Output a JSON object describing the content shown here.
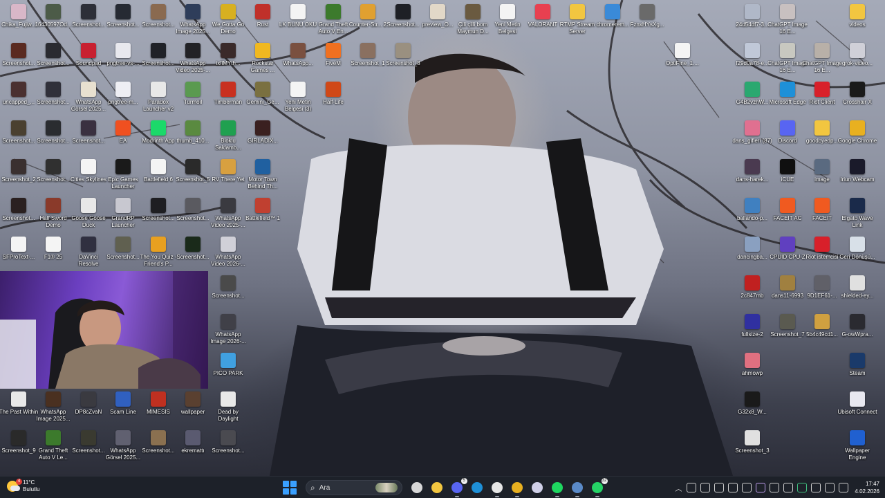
{
  "colors": {
    "taskbar": "#1d2129",
    "accent": "#3aa0ff",
    "label_text": "#ffffff"
  },
  "desktop": {
    "icons": [
      {
        "label": "Chika_Fujiw...",
        "icon": "photo-icon",
        "color": "#d9b7c8"
      },
      {
        "label": "16430597Od...",
        "icon": "photo-icon",
        "color": "#4c5b48"
      },
      {
        "label": "Screenshot...",
        "icon": "screenshot-icon",
        "color": "#2d2f38"
      },
      {
        "label": "Screenshot...",
        "icon": "screenshot-icon",
        "color": "#262a33"
      },
      {
        "label": "Screenshot...",
        "icon": "screenshot-icon",
        "color": "#8a6a50"
      },
      {
        "label": "WhatsApp Image 2025...",
        "icon": "photo-icon",
        "color": "#2e3d5a"
      },
      {
        "label": "We Gotta Go Demo",
        "icon": "game-icon",
        "color": "#d8b020"
      },
      {
        "label": "Rust",
        "icon": "rust-icon",
        "color": "#c0302a"
      },
      {
        "label": "LK BUNU OKU",
        "icon": "text-file-icon",
        "color": "#f4f4f4"
      },
      {
        "label": "Grand Theft Auto V En...",
        "icon": "gta-icon",
        "color": "#3c7a2c"
      },
      {
        "label": "Counter-Str... 2",
        "icon": "cs2-icon",
        "color": "#e0a030"
      },
      {
        "label": "Screenshot...",
        "icon": "screenshot-icon",
        "color": "#1e2026"
      },
      {
        "label": "preview_O...",
        "icon": "photo-icon",
        "color": "#e2d8c8"
      },
      {
        "label": "Çili çilli bom Maymun D...",
        "icon": "photo-icon",
        "color": "#6a5a40"
      },
      {
        "label": "Yeni Metin Belgesi",
        "icon": "text-file-icon",
        "color": "#f4f4f4"
      },
      {
        "label": "VALORANT",
        "icon": "valorant-icon",
        "color": "#e84050"
      },
      {
        "label": "RTMP Stream Server",
        "icon": "folder-icon",
        "color": "#f2c640"
      },
      {
        "label": "chromerem...",
        "icon": "chrome-remote-icon",
        "color": "#3a8ad8"
      },
      {
        "label": "FznxHYsXg...",
        "icon": "photo-icon",
        "color": "#6a6a6a"
      },
      {
        "label": "24d54df7-3...",
        "icon": "photo-icon",
        "color": "#b0b8c8"
      },
      {
        "label": "ChatGPT Image 16 E...",
        "icon": "photo-icon",
        "color": "#c8c0c0"
      },
      {
        "label": "videos",
        "icon": "folder-icon",
        "color": "#f2c640"
      },
      {
        "label": "Screenshot...",
        "icon": "screenshot-icon",
        "color": "#5a2a20"
      },
      {
        "label": "Screenshot...",
        "icon": "screenshot-icon",
        "color": "#2a2a30"
      },
      {
        "label": "Soundpad",
        "icon": "soundpad-icon",
        "color": "#c82030"
      },
      {
        "label": "pngtree-vs-...",
        "icon": "photo-icon",
        "color": "#e8e8ee"
      },
      {
        "label": "Screenshot...",
        "icon": "screenshot-icon",
        "color": "#202228"
      },
      {
        "label": "WhatsApp Video 2025-...",
        "icon": "video-icon",
        "color": "#222226"
      },
      {
        "label": "ixflMYth...",
        "icon": "photo-icon",
        "color": "#3a2a2a"
      },
      {
        "label": "Rockstar Games ...",
        "icon": "rockstar-icon",
        "color": "#f0b820"
      },
      {
        "label": "WhatsApp...",
        "icon": "photo-icon",
        "color": "#7a5040"
      },
      {
        "label": "FiveM",
        "icon": "fivem-icon",
        "color": "#f07020"
      },
      {
        "label": "Screenshot_1",
        "icon": "screenshot-icon",
        "color": "#8a7060"
      },
      {
        "label": "Screenshot_8",
        "icon": "screenshot-icon",
        "color": "#9a9080"
      },
      {
        "label": "OptiFine_1....",
        "icon": "java-icon",
        "color": "#f4f4f4"
      },
      {
        "label": "f29d0a78-e...",
        "icon": "photo-icon",
        "color": "#c0c8d8"
      },
      {
        "label": "ChatGPT Image 16 E...",
        "icon": "photo-icon",
        "color": "#c8c8c0"
      },
      {
        "label": "ChatGPT Image 16 E...",
        "icon": "photo-icon",
        "color": "#b8b0a8"
      },
      {
        "label": "grok-video...",
        "icon": "video-icon",
        "color": "#d0d0d8"
      },
      {
        "label": "uncapped_...",
        "icon": "photo-icon",
        "color": "#4a3030"
      },
      {
        "label": "Screenshot...",
        "icon": "screenshot-icon",
        "color": "#30303a"
      },
      {
        "label": "WhatsApp Görsel 2025...",
        "icon": "photo-icon",
        "color": "#e8e0d0"
      },
      {
        "label": "pngtree-m...",
        "icon": "photo-icon",
        "color": "#eeeef4"
      },
      {
        "label": "Paradox Launcher v2",
        "icon": "paradox-icon",
        "color": "#e8e8e8"
      },
      {
        "label": "Turmoil",
        "icon": "game-icon",
        "color": "#5a9a50"
      },
      {
        "label": "Timberman",
        "icon": "game-icon",
        "color": "#c83020"
      },
      {
        "label": "Gemini_Ge...",
        "icon": "photo-icon",
        "color": "#7a7040"
      },
      {
        "label": "Yeni Metin Belgesi (3)",
        "icon": "text-file-icon",
        "color": "#f4f4f4"
      },
      {
        "label": "Half-Life",
        "icon": "halflife-icon",
        "color": "#d04818"
      },
      {
        "label": "G4B2vzhW...",
        "icon": "edge-icon",
        "color": "#2aa870"
      },
      {
        "label": "Microsoft Edge",
        "icon": "edge-icon",
        "color": "#1e90d8"
      },
      {
        "label": "Riot Client",
        "icon": "riot-icon",
        "color": "#d8202a"
      },
      {
        "label": "Crosshair X",
        "icon": "crosshair-icon",
        "color": "#1a1a1a"
      },
      {
        "label": "Screenshot...",
        "icon": "screenshot-icon",
        "color": "#4a4030"
      },
      {
        "label": "Screenshot...",
        "icon": "screenshot-icon",
        "color": "#2a2c30"
      },
      {
        "label": "Screenshot...",
        "icon": "screenshot-icon",
        "color": "#3a3040"
      },
      {
        "label": "EA",
        "icon": "ea-icon",
        "color": "#f05020"
      },
      {
        "label": "Modrinth App",
        "icon": "modrinth-icon",
        "color": "#1bd96a"
      },
      {
        "label": "thumb_410...",
        "icon": "photo-icon",
        "color": "#5a8a40"
      },
      {
        "label": "Bloklu Saklamb...",
        "icon": "game-icon",
        "color": "#20a050"
      },
      {
        "label": "GIRLADIX...",
        "icon": "photo-icon",
        "color": "#3a2020"
      },
      {
        "label": "dans_gifleri (87)",
        "icon": "gif-icon",
        "color": "#e07090"
      },
      {
        "label": "Discord",
        "icon": "discord-icon",
        "color": "#5865f2"
      },
      {
        "label": "goodbyedp...",
        "icon": "folder-icon",
        "color": "#f2c640"
      },
      {
        "label": "Google Chrome",
        "icon": "chrome-icon",
        "color": "#e8b020"
      },
      {
        "label": "Screenshot_2",
        "icon": "screenshot-icon",
        "color": "#3a3030"
      },
      {
        "label": "Screenshot...",
        "icon": "screenshot-icon",
        "color": "#303030"
      },
      {
        "label": "Cities Skylines",
        "icon": "text-file-icon",
        "color": "#f4f4f4"
      },
      {
        "label": "Epic Games Launcher",
        "icon": "epic-icon",
        "color": "#1a1a1a"
      },
      {
        "label": "Battlefield 6",
        "icon": "text-file-icon",
        "color": "#f4f4f4"
      },
      {
        "label": "Screenshot_5",
        "icon": "screenshot-icon",
        "color": "#2a2a2a"
      },
      {
        "label": "RV There Yet",
        "icon": "game-icon",
        "color": "#d8a040"
      },
      {
        "label": "Motor Town Behind Th...",
        "icon": "game-icon",
        "color": "#2060a0"
      },
      {
        "label": "dans-harek...",
        "icon": "gif-icon",
        "color": "#4a3a50"
      },
      {
        "label": "iCUE",
        "icon": "icue-icon",
        "color": "#101010"
      },
      {
        "label": "image",
        "icon": "photo-icon",
        "color": "#5a6a80"
      },
      {
        "label": "Iriun Webcam",
        "icon": "webcam-icon",
        "color": "#1a1a2a"
      },
      {
        "label": "Screenshot...",
        "icon": "screenshot-icon",
        "color": "#2a2020"
      },
      {
        "label": "Half Sword Demo",
        "icon": "game-icon",
        "color": "#8a3a2a"
      },
      {
        "label": "Goose Goose Duck",
        "icon": "game-icon",
        "color": "#e8e8e8"
      },
      {
        "label": "GrandRP Launcher",
        "icon": "grandrp-icon",
        "color": "#c8c8d0"
      },
      {
        "label": "Screenshot...",
        "icon": "screenshot-icon",
        "color": "#1e1e22"
      },
      {
        "label": "Screenshot...",
        "icon": "screenshot-icon",
        "color": "#5a5a60"
      },
      {
        "label": "WhatsApp Video 2025-...",
        "icon": "video-icon",
        "color": "#3a3a40"
      },
      {
        "label": "Battlefield™ 1",
        "icon": "game-icon",
        "color": "#c04030"
      },
      {
        "label": "ballando-p...",
        "icon": "gif-icon",
        "color": "#4080c0"
      },
      {
        "label": "FACEIT AC",
        "icon": "faceit-icon",
        "color": "#f05a20"
      },
      {
        "label": "FACEIT",
        "icon": "faceit-icon",
        "color": "#f05a20"
      },
      {
        "label": "Elgato Wave Link",
        "icon": "elgato-icon",
        "color": "#1a2a4a"
      },
      {
        "label": "SFProText-...",
        "icon": "font-file-icon",
        "color": "#f4f4f4"
      },
      {
        "label": "F1® 25",
        "icon": "text-file-icon",
        "color": "#f4f4f4"
      },
      {
        "label": "DaVinci Resolve",
        "icon": "davinci-icon",
        "color": "#303040"
      },
      {
        "label": "Screenshot...",
        "icon": "screenshot-icon",
        "color": "#606050"
      },
      {
        "label": "The You Quiz - Friend's P...",
        "icon": "game-icon",
        "color": "#e8a020"
      },
      {
        "label": "Screenshot...",
        "icon": "screenshot-icon",
        "color": "#1a2a1a"
      },
      {
        "label": "WhatsApp Video 2026-...",
        "icon": "video-icon",
        "color": "#d0d0d8"
      },
      {
        "label": "dancingba...",
        "icon": "gif-icon",
        "color": "#8aa0c0"
      },
      {
        "label": "CPUID CPU-Z",
        "icon": "cpuz-icon",
        "color": "#6040c0"
      },
      {
        "label": "Riot istemcisi",
        "icon": "riot-icon",
        "color": "#d8202a"
      },
      {
        "label": "Geri Dönüşü...",
        "icon": "recycle-bin-icon",
        "color": "#d8e0e8"
      },
      {
        "label": "Screenshot...",
        "icon": "screenshot-icon",
        "color": "#4a4a4a"
      },
      {
        "label": "2c847mb",
        "icon": "gif-icon",
        "color": "#c02020"
      },
      {
        "label": "dans11-6993",
        "icon": "gif-icon",
        "color": "#a08040"
      },
      {
        "label": "9D1EF61-...",
        "icon": "photo-icon",
        "color": "#606068"
      },
      {
        "label": "shielded-ey...",
        "icon": "photo-icon",
        "color": "#e0e0e0"
      },
      {
        "label": "WhatsApp Image 2026-...",
        "icon": "photo-icon",
        "color": "#404048"
      },
      {
        "label": "fullsize-2",
        "icon": "photo-icon",
        "color": "#3030a0"
      },
      {
        "label": "Screenshot_7",
        "icon": "screenshot-icon",
        "color": "#5a5a50"
      },
      {
        "label": "5b4c49cd1...",
        "icon": "gif-icon",
        "color": "#d0a040"
      },
      {
        "label": "G-owWpra...",
        "icon": "photo-icon",
        "color": "#2a2a30"
      },
      {
        "label": "PICO PARK",
        "icon": "game-icon",
        "color": "#40a0e0"
      },
      {
        "label": "ahmowp",
        "icon": "gif-icon",
        "color": "#e07080"
      },
      {
        "label": "Steam",
        "icon": "steam-icon",
        "color": "#1a3a6a"
      },
      {
        "label": "The Past Within",
        "icon": "game-icon",
        "color": "#e8e8e8"
      },
      {
        "label": "WhatsApp Image 2025...",
        "icon": "photo-icon",
        "color": "#4a3020"
      },
      {
        "label": "DP8cZvaN",
        "icon": "photo-icon",
        "color": "#3a3a40"
      },
      {
        "label": "Scam Line",
        "icon": "game-icon",
        "color": "#3060c0"
      },
      {
        "label": "MIMESIS",
        "icon": "game-icon",
        "color": "#c03020"
      },
      {
        "label": "wallpaper",
        "icon": "photo-icon",
        "color": "#5a4030"
      },
      {
        "label": "Dead by Daylight",
        "icon": "game-icon",
        "color": "#e8e8e8"
      },
      {
        "label": "G32x8_W...",
        "icon": "photo-icon",
        "color": "#1a1a1a"
      },
      {
        "label": "Ubisoft Connect",
        "icon": "ubisoft-icon",
        "color": "#e8e8f0"
      },
      {
        "label": "Screenshot_9",
        "icon": "screenshot-icon",
        "color": "#2a2a2a"
      },
      {
        "label": "Grand Theft Auto V Le...",
        "icon": "gta-icon",
        "color": "#3c7a2c"
      },
      {
        "label": "Screenshot...",
        "icon": "screenshot-icon",
        "color": "#3a3a30"
      },
      {
        "label": "WhatsApp Görsel 2025...",
        "icon": "photo-icon",
        "color": "#606070"
      },
      {
        "label": "Screenshot...",
        "icon": "screenshot-icon",
        "color": "#8a7050"
      },
      {
        "label": "ekremattı",
        "icon": "photo-icon",
        "color": "#5a5a70"
      },
      {
        "label": "Screenshot...",
        "icon": "screenshot-icon",
        "color": "#4a4a50"
      },
      {
        "label": "Screenshot_3",
        "icon": "screenshot-icon",
        "color": "#e0e0e0"
      },
      {
        "label": "Wallpaper Engine",
        "icon": "wallpaper-engine-icon",
        "color": "#2060d0"
      }
    ]
  },
  "taskbar": {
    "weather": {
      "temp": "11°C",
      "condition": "Bulutlu",
      "badge": "4"
    },
    "search_placeholder": "Ara",
    "pinned": [
      {
        "icon": "task-view-icon",
        "color": "#d8d8d8",
        "active": false
      },
      {
        "icon": "file-explorer-icon",
        "color": "#f2c640",
        "active": false
      },
      {
        "icon": "discord-icon",
        "color": "#5865f2",
        "active": true,
        "count": "5"
      },
      {
        "icon": "edge-icon",
        "color": "#1e90d8",
        "active": false
      },
      {
        "icon": "obs-icon",
        "color": "#e6e6e6",
        "active": true
      },
      {
        "icon": "chrome-icon",
        "color": "#e8b020",
        "active": true
      },
      {
        "icon": "media-player-icon",
        "color": "#d0d0e8",
        "active": false
      },
      {
        "icon": "spotify-icon",
        "color": "#1ed760",
        "active": true
      },
      {
        "icon": "steam-icon",
        "color": "#5a8ac8",
        "active": true
      },
      {
        "icon": "whatsapp-icon",
        "color": "#25d366",
        "active": true,
        "count": "32"
      }
    ],
    "tray_icons": [
      {
        "icon": "refresh-icon",
        "color": "#d0d0d0"
      },
      {
        "icon": "discord-icon",
        "color": "#d0d0d0"
      },
      {
        "icon": "riot-icon",
        "color": "#d0d0d0"
      },
      {
        "icon": "tray-app-icon",
        "color": "#d0d0d0"
      },
      {
        "icon": "steam-icon",
        "color": "#d0d0d0"
      },
      {
        "icon": "feather-icon",
        "color": "#c0a0f0"
      },
      {
        "icon": "arrows-icon",
        "color": "#d0d0d0"
      },
      {
        "icon": "bluetooth-icon",
        "color": "#d0d0d0"
      },
      {
        "icon": "shield-icon",
        "color": "#40c080"
      },
      {
        "icon": "microphone-icon",
        "color": "#d0d0d0"
      },
      {
        "icon": "network-icon",
        "color": "#d0d0d0"
      },
      {
        "icon": "volume-icon",
        "color": "#d0d0d0"
      }
    ],
    "time": "17:47",
    "date": "4.02.2026"
  }
}
